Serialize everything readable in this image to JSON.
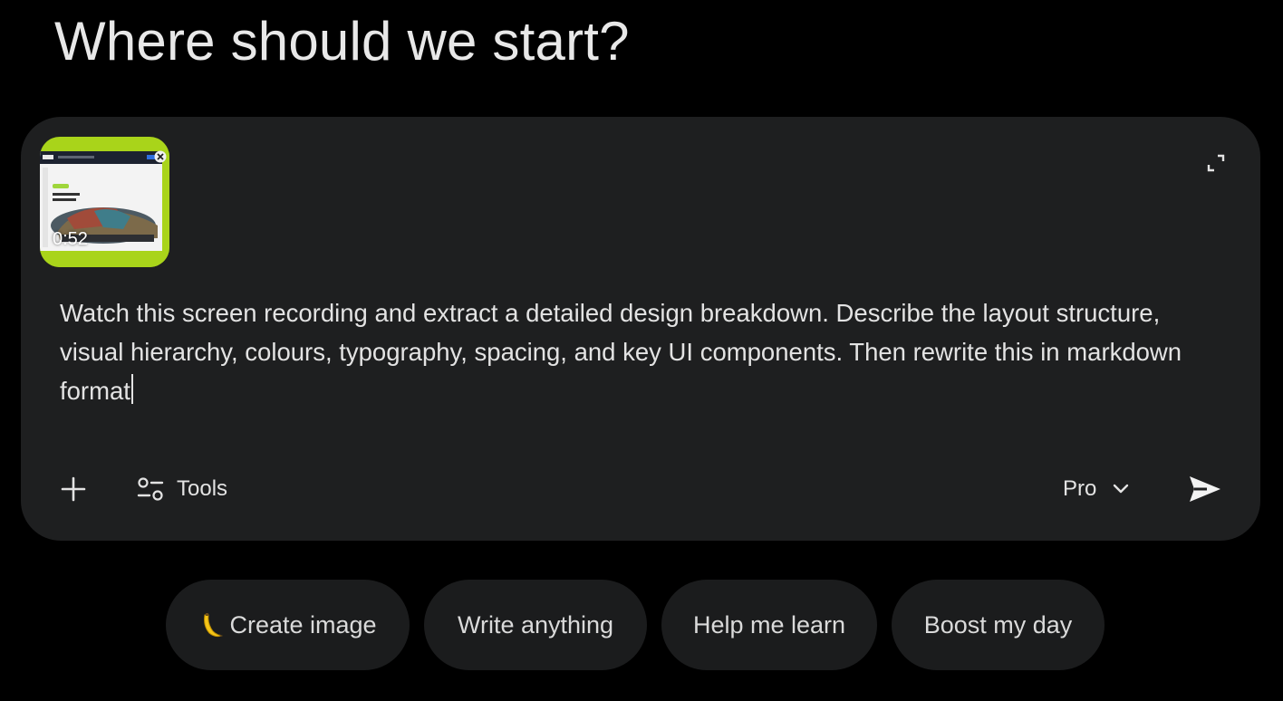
{
  "page": {
    "heading": "Where should we start?"
  },
  "composer": {
    "attachment": {
      "duration": "0:52",
      "icon": "video-thumbnail"
    },
    "prompt_text": "Watch this screen recording and extract a detailed design breakdown. Describe the layout structure, visual hierarchy, colours, typography, spacing, and key UI components. Then rewrite this in markdown format",
    "toolbar": {
      "add_icon": "plus-icon",
      "tools_label": "Tools",
      "tools_icon": "sliders-icon",
      "model_label": "Pro",
      "model_icon": "chevron-down-icon",
      "send_icon": "send-icon",
      "expand_icon": "expand-icon"
    }
  },
  "suggestions": [
    {
      "label": "Create image",
      "icon": "banana-emoji"
    },
    {
      "label": "Write anything"
    },
    {
      "label": "Help me learn"
    },
    {
      "label": "Boost my day"
    }
  ],
  "colors": {
    "background": "#000000",
    "composer": "#1e1f20",
    "chip": "#1b1c1d",
    "text": "#e3e3e3",
    "attachment_accent": "#a9d41a"
  }
}
